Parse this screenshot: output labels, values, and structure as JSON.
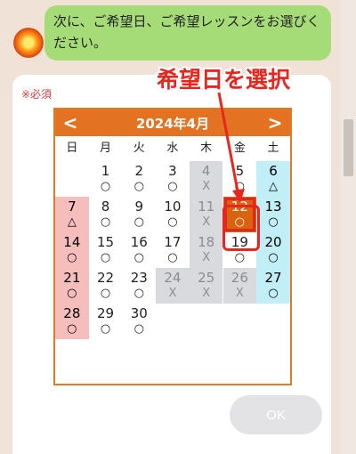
{
  "chat": {
    "message": "次に、ご希望日、ご希望レッスンをお選びください。"
  },
  "form": {
    "required_label": "※必須",
    "ok_label": "OK"
  },
  "calendar": {
    "title": "2024年4月",
    "prev_label": "<",
    "next_label": ">",
    "weekdays": [
      "日",
      "月",
      "火",
      "水",
      "木",
      "金",
      "土"
    ],
    "weeks": [
      [
        null,
        {
          "day": "1",
          "mark": "○"
        },
        {
          "day": "2",
          "mark": "○"
        },
        {
          "day": "3",
          "mark": "○"
        },
        {
          "day": "4",
          "mark": "X"
        },
        {
          "day": "5",
          "mark": "○"
        },
        {
          "day": "6",
          "mark": "△"
        }
      ],
      [
        {
          "day": "7",
          "mark": "△"
        },
        {
          "day": "8",
          "mark": "○"
        },
        {
          "day": "9",
          "mark": "○"
        },
        {
          "day": "10",
          "mark": "○"
        },
        {
          "day": "11",
          "mark": "X"
        },
        {
          "day": "12",
          "mark": "○"
        },
        {
          "day": "13",
          "mark": "○"
        }
      ],
      [
        {
          "day": "14",
          "mark": "○"
        },
        {
          "day": "15",
          "mark": "○"
        },
        {
          "day": "16",
          "mark": "○"
        },
        {
          "day": "17",
          "mark": "○"
        },
        {
          "day": "18",
          "mark": "X"
        },
        {
          "day": "19",
          "mark": "○"
        },
        {
          "day": "20",
          "mark": "○"
        }
      ],
      [
        {
          "day": "21",
          "mark": "○"
        },
        {
          "day": "22",
          "mark": "○"
        },
        {
          "day": "23",
          "mark": "○"
        },
        {
          "day": "24",
          "mark": "X"
        },
        {
          "day": "25",
          "mark": "X"
        },
        {
          "day": "26",
          "mark": "X"
        },
        {
          "day": "27",
          "mark": "○"
        }
      ],
      [
        {
          "day": "28",
          "mark": "○"
        },
        {
          "day": "29",
          "mark": "○"
        },
        {
          "day": "30",
          "mark": "○"
        },
        null,
        null,
        null,
        null
      ]
    ],
    "selected_day": "12"
  },
  "annotation": {
    "label": "希望日を選択"
  },
  "colors": {
    "header": "#e37323",
    "selected": "#d9630f",
    "sunday": "#f6bdbd",
    "saturday": "#c2eef8",
    "unavailable": "#d9dade",
    "annotation": "#e8261e"
  }
}
